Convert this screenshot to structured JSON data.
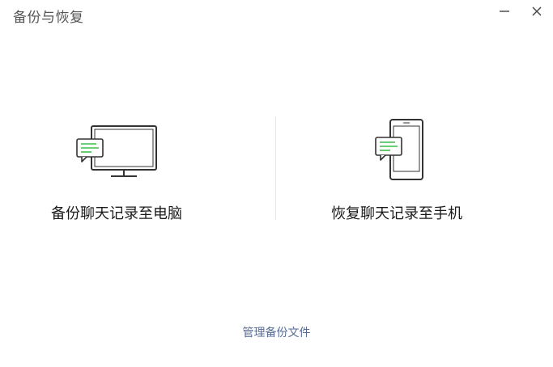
{
  "window": {
    "title": "备份与恢复"
  },
  "controls": {
    "minimize_icon": "minimize-icon",
    "close_icon": "close-icon"
  },
  "options": {
    "backup": {
      "label": "备份聊天记录至电脑",
      "icon": "monitor-chat-icon"
    },
    "restore": {
      "label": "恢复聊天记录至手机",
      "icon": "phone-chat-icon"
    }
  },
  "footer": {
    "manage_label": "管理备份文件"
  },
  "colors": {
    "accent_green": "#3cbf4a",
    "link": "#576b95",
    "title": "#555555"
  }
}
